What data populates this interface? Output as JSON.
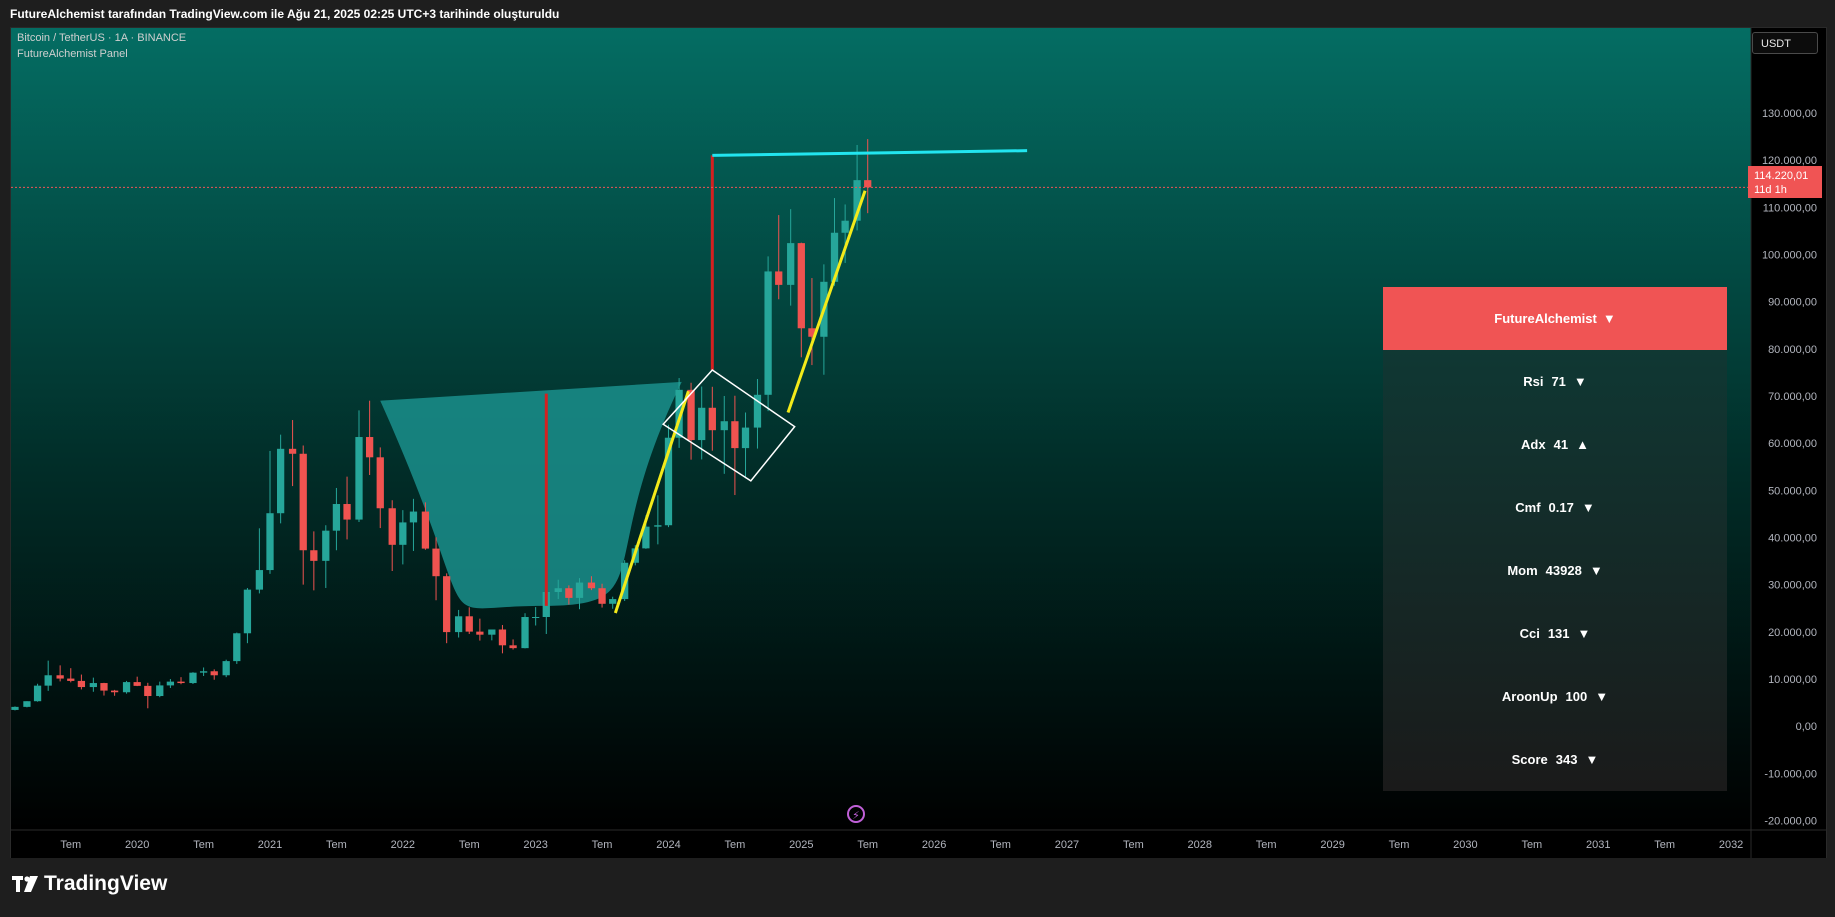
{
  "caption": "FutureAlchemist tarafından TradingView.com ile Ağu 21, 2025 02:25 UTC+3 tarihinde oluşturuldu",
  "symbol_line": "Bitcoin / TetherUS · 1A · BINANCE",
  "indicator_line": "FutureAlchemist Panel",
  "currency": "USDT",
  "last_price": {
    "value": "114.220,01",
    "countdown": "11d 1h"
  },
  "brand": "TradingView",
  "colors": {
    "up": "#26a69a",
    "down": "#ef5350",
    "bg_top": "#046d63",
    "bg_bottom": "#000000",
    "cup_fill": "#1a8f8c",
    "trend_yellow": "#f3ea1a",
    "resistance_cyan": "#22e5f0",
    "panel_header": "#f05454"
  },
  "panel": {
    "title": "FutureAlchemist",
    "title_icon": "▼",
    "rows": [
      {
        "label": "Rsi",
        "value": "71",
        "arrow": "▼"
      },
      {
        "label": "Adx",
        "value": "41",
        "arrow": "▲"
      },
      {
        "label": "Cmf",
        "value": "0.17",
        "arrow": "▼"
      },
      {
        "label": "Mom",
        "value": "43928",
        "arrow": "▼"
      },
      {
        "label": "Cci",
        "value": "131",
        "arrow": "▼"
      },
      {
        "label": "AroonUp",
        "value": "100",
        "arrow": "▼"
      },
      {
        "label": "Score",
        "value": "343",
        "arrow": "▼"
      }
    ]
  },
  "chart_data": {
    "type": "candlestick",
    "symbol": "BTCUSDT",
    "timeframe": "1A",
    "y_ticks": [
      "130.000,00",
      "120.000,00",
      "110.000,00",
      "100.000,00",
      "90.000,00",
      "80.000,00",
      "70.000,00",
      "60.000,00",
      "50.000,00",
      "40.000,00",
      "30.000,00",
      "20.000,00",
      "10.000,00",
      "0,00",
      "-10.000,00",
      "-20.000,00"
    ],
    "y_tick_values": [
      130000,
      120000,
      110000,
      100000,
      90000,
      80000,
      70000,
      60000,
      50000,
      40000,
      30000,
      20000,
      10000,
      0,
      -10000,
      -20000
    ],
    "ylim": [
      -22000,
      148000
    ],
    "x_ticks": [
      "Tem",
      "2020",
      "Tem",
      "2021",
      "Tem",
      "2022",
      "Tem",
      "2023",
      "Tem",
      "2024",
      "Tem",
      "2025",
      "Tem",
      "2026",
      "Tem",
      "2027",
      "Tem",
      "2028",
      "Tem",
      "2029",
      "Tem",
      "2030",
      "Tem",
      "2031",
      "Tem",
      "2032"
    ],
    "x_tick_values": [
      2019.5,
      2020,
      2020.5,
      2021,
      2021.5,
      2022,
      2022.5,
      2023,
      2023.5,
      2024,
      2024.5,
      2025,
      2025.5,
      2026,
      2026.5,
      2027,
      2027.5,
      2028,
      2028.5,
      2029,
      2029.5,
      2030,
      2030.5,
      2031,
      2031.5,
      2032
    ],
    "xlim": [
      2019.05,
      2032.15
    ],
    "candles": [
      {
        "t": 2019.0,
        "o": 3700,
        "h": 4100,
        "l": 3350,
        "c": 3450
      },
      {
        "t": 2019.08,
        "o": 3450,
        "h": 4200,
        "l": 3350,
        "c": 4100
      },
      {
        "t": 2019.17,
        "o": 4100,
        "h": 5300,
        "l": 4000,
        "c": 5300
      },
      {
        "t": 2019.25,
        "o": 5300,
        "h": 9000,
        "l": 5200,
        "c": 8600
      },
      {
        "t": 2019.33,
        "o": 8600,
        "h": 13900,
        "l": 7500,
        "c": 10800
      },
      {
        "t": 2019.42,
        "o": 10800,
        "h": 12900,
        "l": 9500,
        "c": 10100
      },
      {
        "t": 2019.5,
        "o": 10100,
        "h": 12300,
        "l": 9300,
        "c": 9600
      },
      {
        "t": 2019.58,
        "o": 9600,
        "h": 10950,
        "l": 7800,
        "c": 8300
      },
      {
        "t": 2019.67,
        "o": 8300,
        "h": 10300,
        "l": 7300,
        "c": 9150
      },
      {
        "t": 2019.75,
        "o": 9150,
        "h": 9200,
        "l": 6500,
        "c": 7550
      },
      {
        "t": 2019.83,
        "o": 7550,
        "h": 7700,
        "l": 6450,
        "c": 7200
      },
      {
        "t": 2019.92,
        "o": 7200,
        "h": 9600,
        "l": 6900,
        "c": 9350
      },
      {
        "t": 2020.0,
        "o": 9350,
        "h": 10500,
        "l": 8500,
        "c": 8550
      },
      {
        "t": 2020.08,
        "o": 8550,
        "h": 9200,
        "l": 3800,
        "c": 6400
      },
      {
        "t": 2020.17,
        "o": 6400,
        "h": 9450,
        "l": 6150,
        "c": 8650
      },
      {
        "t": 2020.25,
        "o": 8650,
        "h": 10000,
        "l": 8100,
        "c": 9450
      },
      {
        "t": 2020.33,
        "o": 9450,
        "h": 10400,
        "l": 8900,
        "c": 9150
      },
      {
        "t": 2020.42,
        "o": 9150,
        "h": 11450,
        "l": 8950,
        "c": 11350
      },
      {
        "t": 2020.5,
        "o": 11350,
        "h": 12450,
        "l": 10650,
        "c": 11650
      },
      {
        "t": 2020.58,
        "o": 11650,
        "h": 12050,
        "l": 9850,
        "c": 10800
      },
      {
        "t": 2020.67,
        "o": 10800,
        "h": 14100,
        "l": 10400,
        "c": 13800
      },
      {
        "t": 2020.75,
        "o": 13800,
        "h": 19850,
        "l": 13200,
        "c": 19700
      },
      {
        "t": 2020.83,
        "o": 19700,
        "h": 29300,
        "l": 17600,
        "c": 28950
      },
      {
        "t": 2020.92,
        "o": 28950,
        "h": 41950,
        "l": 28150,
        "c": 33100
      },
      {
        "t": 2021.0,
        "o": 33100,
        "h": 58350,
        "l": 32300,
        "c": 45150
      },
      {
        "t": 2021.08,
        "o": 45150,
        "h": 61800,
        "l": 43000,
        "c": 58800
      },
      {
        "t": 2021.17,
        "o": 58800,
        "h": 64900,
        "l": 50900,
        "c": 57750
      },
      {
        "t": 2021.25,
        "o": 57750,
        "h": 59500,
        "l": 30000,
        "c": 37300
      },
      {
        "t": 2021.33,
        "o": 37300,
        "h": 41300,
        "l": 28800,
        "c": 35050
      },
      {
        "t": 2021.42,
        "o": 35050,
        "h": 42600,
        "l": 29300,
        "c": 41450
      },
      {
        "t": 2021.5,
        "o": 41450,
        "h": 50500,
        "l": 37300,
        "c": 47100
      },
      {
        "t": 2021.58,
        "o": 47100,
        "h": 52900,
        "l": 39600,
        "c": 43800
      },
      {
        "t": 2021.67,
        "o": 43800,
        "h": 66950,
        "l": 43300,
        "c": 61300
      },
      {
        "t": 2021.75,
        "o": 61300,
        "h": 69000,
        "l": 53250,
        "c": 57000
      },
      {
        "t": 2021.83,
        "o": 57000,
        "h": 59100,
        "l": 42000,
        "c": 46200
      },
      {
        "t": 2021.92,
        "o": 46200,
        "h": 47900,
        "l": 32900,
        "c": 38450
      },
      {
        "t": 2022.0,
        "o": 38450,
        "h": 45800,
        "l": 34300,
        "c": 43200
      },
      {
        "t": 2022.08,
        "o": 43200,
        "h": 48200,
        "l": 37150,
        "c": 45500
      },
      {
        "t": 2022.17,
        "o": 45500,
        "h": 47450,
        "l": 37400,
        "c": 37650
      },
      {
        "t": 2022.25,
        "o": 37650,
        "h": 40050,
        "l": 26700,
        "c": 31800
      },
      {
        "t": 2022.33,
        "o": 31800,
        "h": 32400,
        "l": 17600,
        "c": 19950
      },
      {
        "t": 2022.42,
        "o": 19950,
        "h": 24650,
        "l": 18800,
        "c": 23300
      },
      {
        "t": 2022.5,
        "o": 23300,
        "h": 25200,
        "l": 19550,
        "c": 20050
      },
      {
        "t": 2022.58,
        "o": 20050,
        "h": 22800,
        "l": 18150,
        "c": 19400
      },
      {
        "t": 2022.67,
        "o": 19400,
        "h": 20450,
        "l": 18200,
        "c": 20500
      },
      {
        "t": 2022.75,
        "o": 20500,
        "h": 21450,
        "l": 15450,
        "c": 17150
      },
      {
        "t": 2022.83,
        "o": 17150,
        "h": 18400,
        "l": 16250,
        "c": 16550
      },
      {
        "t": 2022.92,
        "o": 16550,
        "h": 23950,
        "l": 16500,
        "c": 23150
      },
      {
        "t": 2023.0,
        "o": 23150,
        "h": 25250,
        "l": 21350,
        "c": 23150
      },
      {
        "t": 2023.08,
        "o": 23150,
        "h": 29200,
        "l": 19550,
        "c": 28450
      },
      {
        "t": 2023.17,
        "o": 28450,
        "h": 31050,
        "l": 26950,
        "c": 29250
      },
      {
        "t": 2023.25,
        "o": 29250,
        "h": 29850,
        "l": 25800,
        "c": 27200
      },
      {
        "t": 2023.33,
        "o": 27200,
        "h": 31400,
        "l": 24800,
        "c": 30450
      },
      {
        "t": 2023.42,
        "o": 30450,
        "h": 31800,
        "l": 28850,
        "c": 29250
      },
      {
        "t": 2023.5,
        "o": 29250,
        "h": 30200,
        "l": 25150,
        "c": 25950
      },
      {
        "t": 2023.58,
        "o": 25950,
        "h": 27450,
        "l": 24900,
        "c": 26950
      },
      {
        "t": 2023.67,
        "o": 26950,
        "h": 35200,
        "l": 26550,
        "c": 34650
      },
      {
        "t": 2023.75,
        "o": 34650,
        "h": 38400,
        "l": 34100,
        "c": 37700
      },
      {
        "t": 2023.83,
        "o": 37700,
        "h": 44700,
        "l": 37600,
        "c": 42300
      },
      {
        "t": 2023.92,
        "o": 42300,
        "h": 48950,
        "l": 38550,
        "c": 42600
      },
      {
        "t": 2024.0,
        "o": 42600,
        "h": 63900,
        "l": 42200,
        "c": 61150
      },
      {
        "t": 2024.08,
        "o": 61150,
        "h": 73800,
        "l": 59000,
        "c": 71300
      },
      {
        "t": 2024.17,
        "o": 71300,
        "h": 72800,
        "l": 56500,
        "c": 60650
      },
      {
        "t": 2024.25,
        "o": 60650,
        "h": 72000,
        "l": 56550,
        "c": 67500
      },
      {
        "t": 2024.33,
        "o": 67500,
        "h": 71950,
        "l": 58400,
        "c": 62750
      },
      {
        "t": 2024.42,
        "o": 62750,
        "h": 70000,
        "l": 53500,
        "c": 64650
      },
      {
        "t": 2024.5,
        "o": 64650,
        "h": 70050,
        "l": 49000,
        "c": 58950
      },
      {
        "t": 2024.58,
        "o": 58950,
        "h": 66500,
        "l": 52550,
        "c": 63300
      },
      {
        "t": 2024.67,
        "o": 63300,
        "h": 73600,
        "l": 58850,
        "c": 70250
      },
      {
        "t": 2024.75,
        "o": 70250,
        "h": 99600,
        "l": 66800,
        "c": 96400
      },
      {
        "t": 2024.83,
        "o": 96400,
        "h": 108350,
        "l": 90500,
        "c": 93550
      },
      {
        "t": 2024.92,
        "o": 93550,
        "h": 109600,
        "l": 89150,
        "c": 102400
      },
      {
        "t": 2025.0,
        "o": 102400,
        "h": 102500,
        "l": 78200,
        "c": 84350
      },
      {
        "t": 2025.08,
        "o": 84350,
        "h": 95000,
        "l": 76550,
        "c": 82550
      },
      {
        "t": 2025.17,
        "o": 82550,
        "h": 97900,
        "l": 74500,
        "c": 94200
      },
      {
        "t": 2025.25,
        "o": 94200,
        "h": 111950,
        "l": 93350,
        "c": 104600
      },
      {
        "t": 2025.33,
        "o": 104600,
        "h": 110600,
        "l": 98200,
        "c": 107150
      },
      {
        "t": 2025.42,
        "o": 107150,
        "h": 123200,
        "l": 105100,
        "c": 115750
      },
      {
        "t": 2025.5,
        "o": 115750,
        "h": 124450,
        "l": 108750,
        "c": 114220
      }
    ],
    "last_price_value": 114220.01
  }
}
